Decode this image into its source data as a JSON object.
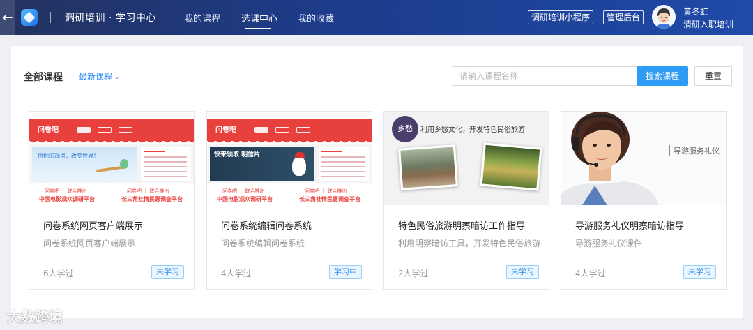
{
  "header": {
    "back_icon": "arrow-left-icon",
    "logo_icon": "cube-logo-icon",
    "app_title": "调研培训 · 学习中心",
    "tabs": [
      {
        "label": "我的课程"
      },
      {
        "label": "选课中心",
        "active": true
      },
      {
        "label": "我的收藏"
      }
    ],
    "mini_program_label": "调研培训小程序",
    "admin_label": "管理后台",
    "user": {
      "name": "黄冬虹",
      "org": "清研入职培训"
    }
  },
  "toolbar": {
    "section_title": "全部课程",
    "sort_label": "最新课程",
    "search_placeholder": "请输入课程名称",
    "search_button": "搜索课程",
    "reset_button": "重置"
  },
  "courses": [
    {
      "title": "问卷系统网页客户端展示",
      "description": "问卷系统网页客户端展示",
      "learners": "6人学过",
      "status": "未学习",
      "thumb": {
        "brand": "问卷吧",
        "tagline_left": "中国电影观众调研平台",
        "tagline_right": "长三角杜情民意调查平台",
        "banner": "用你的观点，改变世界！"
      }
    },
    {
      "title": "问卷系统编辑问卷系统",
      "description": "问卷系统编辑问卷系统",
      "learners": "4人学过",
      "status": "学习中",
      "thumb": {
        "brand": "问卷吧",
        "tagline_left": "中国电影观众调研平台",
        "tagline_right": "长三角杜情民意调查平台",
        "banner": "快来领取 明信片"
      }
    },
    {
      "title": "特色民俗旅游明察暗访工作指导",
      "description": "利用明察暗访工具，开发特色民俗旅游",
      "learners": "2人学过",
      "status": "未学习",
      "thumb": {
        "badge": "乡愁",
        "caption": "利用乡愁文化，开发特色民俗旅游"
      }
    },
    {
      "title": "导游服务礼仪明察暗访指导",
      "description": "导游服务礼仪课件",
      "learners": "4人学过",
      "status": "未学习",
      "thumb": {
        "caption": "导游服务礼仪"
      }
    }
  ],
  "colors": {
    "header": "#1d3c8c",
    "accent": "#2e9cf5",
    "brand_red": "#e8403d",
    "badge_bg": "#eaf6ff"
  },
  "watermark": "大数跨境"
}
